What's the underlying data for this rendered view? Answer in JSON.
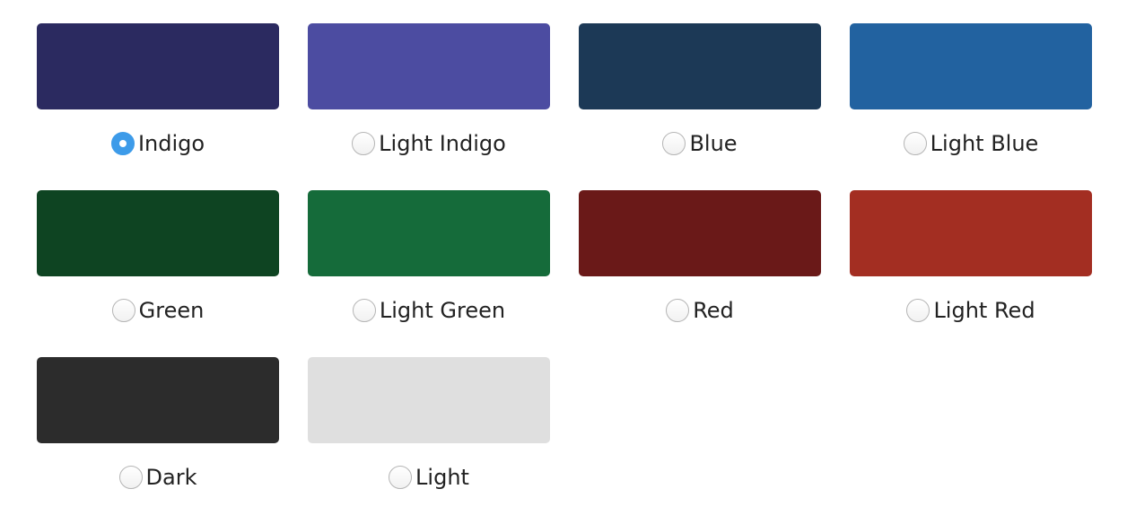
{
  "selected": "Indigo",
  "options": [
    {
      "label": "Indigo",
      "color": "#2b2a60",
      "checked": true
    },
    {
      "label": "Light Indigo",
      "color": "#4c4ca1",
      "checked": false
    },
    {
      "label": "Blue",
      "color": "#1c3956",
      "checked": false
    },
    {
      "label": "Light Blue",
      "color": "#2262a0",
      "checked": false
    },
    {
      "label": "Green",
      "color": "#0e4422",
      "checked": false
    },
    {
      "label": "Light Green",
      "color": "#156b3a",
      "checked": false
    },
    {
      "label": "Red",
      "color": "#6a1918",
      "checked": false
    },
    {
      "label": "Light Red",
      "color": "#a32e22",
      "checked": false
    },
    {
      "label": "Dark",
      "color": "#2c2c2c",
      "checked": false
    },
    {
      "label": "Light",
      "color": "#dfdfdf",
      "checked": false
    }
  ]
}
